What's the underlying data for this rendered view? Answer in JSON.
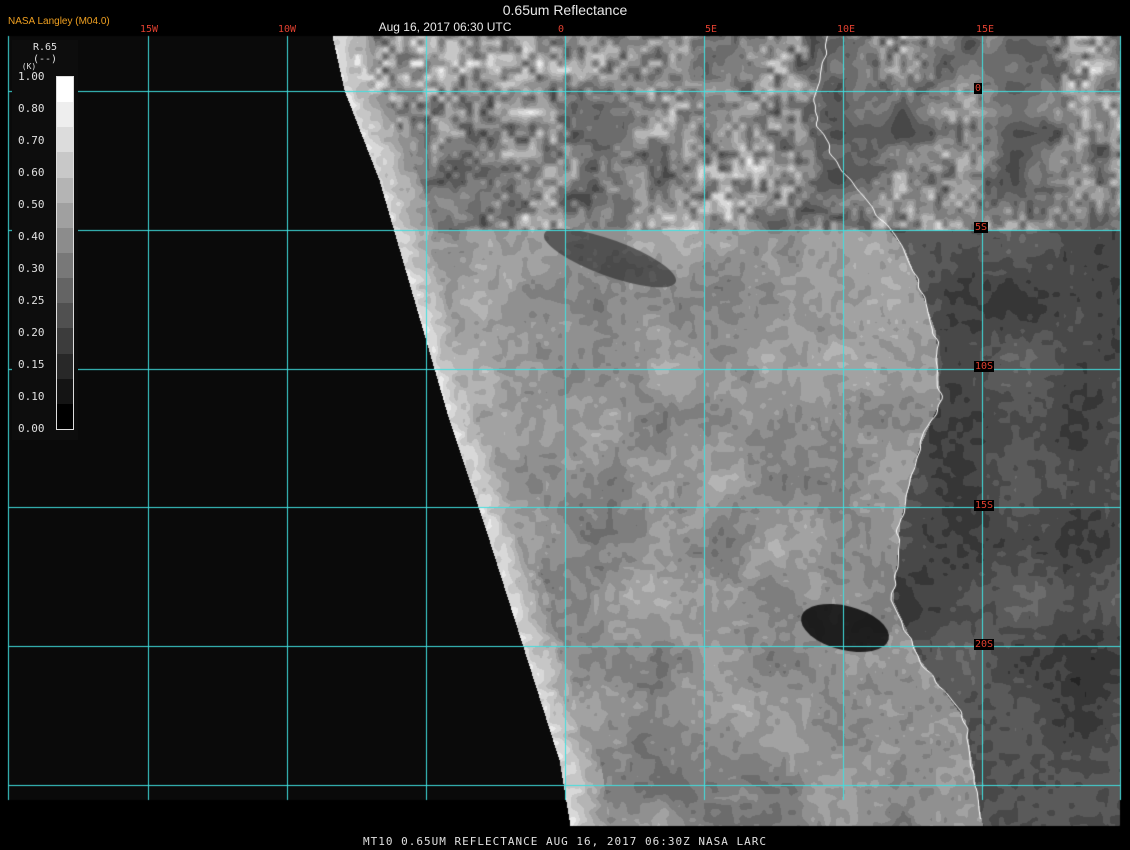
{
  "header": {
    "title": "0.65um Reflectance",
    "datetime": "Aug 16, 2017 06:30 UTC",
    "source": "NASA Langley (M04.0)"
  },
  "footer": {
    "caption": "MT10  0.65UM REFLECTANCE   AUG 16, 2017 06:30Z   NASA LARC"
  },
  "legend": {
    "variable": "R.65",
    "unit": "(--)",
    "mark": "(K)",
    "ticks": [
      "1.00",
      "0.80",
      "0.70",
      "0.60",
      "0.50",
      "0.40",
      "0.30",
      "0.25",
      "0.20",
      "0.15",
      "0.10",
      "0.00"
    ],
    "colors": [
      "#ffffff",
      "#eeeeee",
      "#dcdcdc",
      "#c8c8c8",
      "#b4b4b4",
      "#a0a0a0",
      "#8c8c8c",
      "#787878",
      "#646464",
      "#505050",
      "#3c3c3c",
      "#282828",
      "#141414",
      "#000000"
    ]
  },
  "map": {
    "grid_color": "#40e0e0",
    "coast_color": "#ffffff",
    "lon_labels": [
      "15W",
      "10W",
      "0",
      "5E",
      "10E",
      "15E"
    ],
    "lat_labels": [
      "0",
      "5S",
      "10S",
      "15S",
      "20S"
    ]
  }
}
